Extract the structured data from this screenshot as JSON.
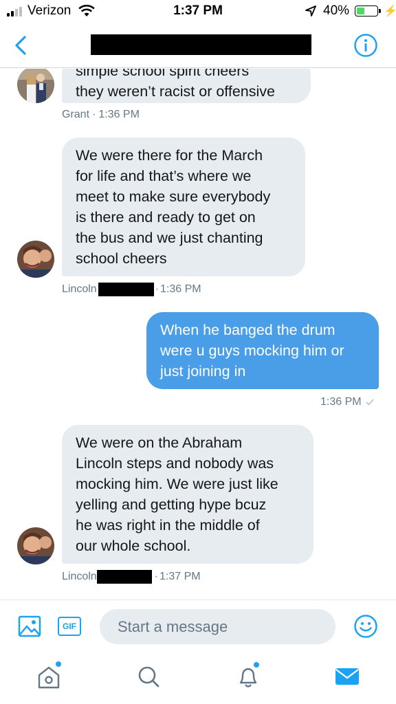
{
  "status_bar": {
    "carrier": "Verizon",
    "time": "1:37 PM",
    "battery": "40%",
    "battery_level": 0.4,
    "signal_bars": 4,
    "signal_strength": 2
  },
  "header": {
    "back_icon": "chevron-left-icon",
    "title": "",
    "title_redacted": true,
    "info_icon": "info-icon"
  },
  "messages": [
    {
      "direction": "incoming",
      "lines": [
        "simple school spirit cheers",
        "they weren’t racist or offensive"
      ],
      "sender": "Grant",
      "time": "1:36 PM"
    },
    {
      "direction": "incoming",
      "lines": [
        "We were there for the March",
        "for life and that’s where we",
        "meet to make sure everybody",
        "is there and ready to get on",
        "the bus and we just chanting",
        "school cheers"
      ],
      "sender": "Lincoln",
      "time": "1:36 PM"
    },
    {
      "direction": "outgoing",
      "lines": [
        "When he banged the drum",
        "were u guys mocking him or",
        "just joining in"
      ],
      "time": "1:36 PM"
    },
    {
      "direction": "incoming",
      "lines": [
        "We were on the Abraham",
        "Lincoln steps and nobody was",
        "mocking him. We were just like",
        "yelling and getting hype bcuz",
        "he was right in the middle of",
        "our whole school."
      ],
      "sender": "Lincoln",
      "time": "1:37 PM"
    }
  ],
  "composer": {
    "placeholder": "Start a message",
    "media_icon": "image-icon",
    "gif_label": "GIF",
    "emoji_icon": "smiley-icon"
  },
  "tabbar": {
    "tabs": [
      "home-icon",
      "search-icon",
      "bell-icon",
      "mail-icon"
    ],
    "active": "mail-icon"
  },
  "colors": {
    "accent": "#1da1f2",
    "outgoing_bubble": "#4a9ee8",
    "incoming_bubble": "#e6ecf0",
    "meta_text": "#657786"
  }
}
